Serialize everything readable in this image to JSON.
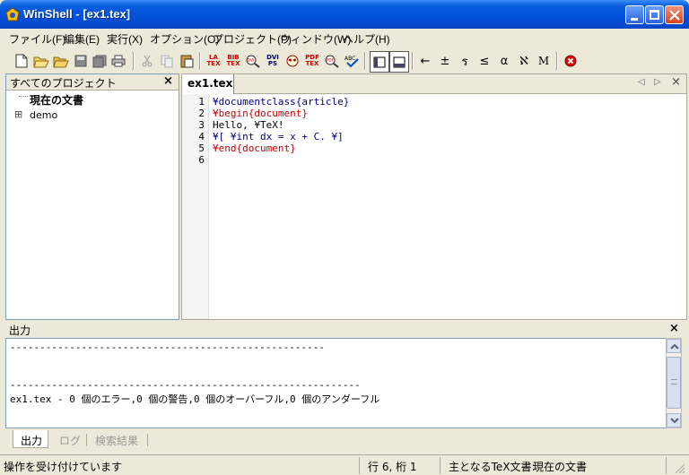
{
  "window": {
    "title": "WinShell - [ex1.tex]"
  },
  "menu": [
    {
      "label": "ファイル(F)"
    },
    {
      "label": "編集(E)"
    },
    {
      "label": "実行(X)"
    },
    {
      "label": "オプション(O)"
    },
    {
      "label": "プロジェクト(P)"
    },
    {
      "label": "ウィンドウ(W)"
    },
    {
      "label": "ヘルプ(H)"
    }
  ],
  "toolbar": {
    "latex_label": "LA\nTEX",
    "bibtex_label": "BIB\nTEX",
    "dvi_label": "DVI",
    "dvips_label": "DVI\nPS",
    "pdftex_label": "PDF\nTEX",
    "pdf_label": "PDF",
    "spell_label": "ABC",
    "symbols": [
      "←",
      "±",
      "ร",
      "≤",
      "α",
      "ℵ",
      "M"
    ]
  },
  "projects": {
    "title": "すべてのプロジェクト",
    "close": "×",
    "current_doc": "現在の文書",
    "expander": "⊞",
    "item": "demo"
  },
  "editor": {
    "tab": "ex1.tex",
    "nav_left": "◁",
    "nav_right": "▷",
    "close": "×",
    "lines": [
      {
        "num": "1",
        "text": "¥documentclass{article}"
      },
      {
        "num": "2",
        "text": "¥begin{document}"
      },
      {
        "num": "3",
        "text": "Hello, ¥TeX!"
      },
      {
        "num": "4",
        "text": "¥[ ¥int dx = x + C. ¥]"
      },
      {
        "num": "5",
        "text": "¥end{document}"
      },
      {
        "num": "6",
        "text": ""
      }
    ],
    "colors": {
      "command": "#00008b",
      "env": "#c00000",
      "text": "#000000"
    }
  },
  "output": {
    "title": "出力",
    "close": "×",
    "lines": [
      "-----------------------------------------------------",
      "",
      "",
      "-----------------------------------------------------------",
      "ex1.tex - 0 個のエラー,0 個の警告,0 個のオーバーフル,0 個のアンダーフル"
    ],
    "tabs": [
      {
        "label": "出力",
        "active": true
      },
      {
        "label": "ログ",
        "active": false
      },
      {
        "label": "検索結果",
        "active": false
      }
    ]
  },
  "status": {
    "message": "操作を受け付けています",
    "position": "行 6, 桁 1",
    "main_doc_label": "主となるTeX文書:",
    "main_doc_value": "現在の文書"
  }
}
